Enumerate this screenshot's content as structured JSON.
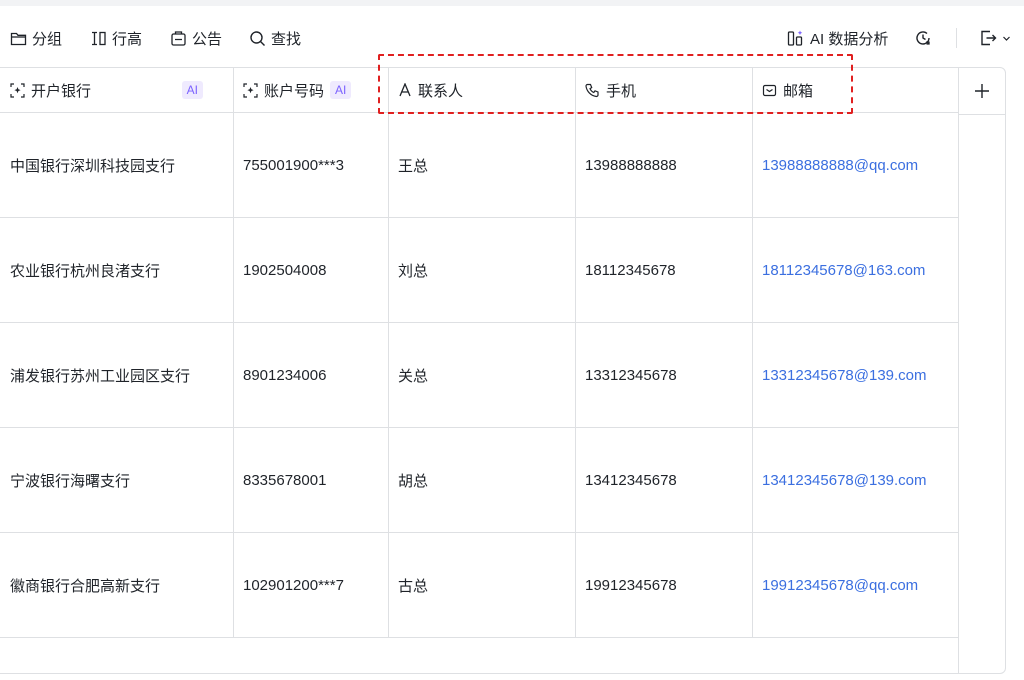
{
  "toolbar": {
    "group": "分组",
    "row_height": "行高",
    "announce": "公告",
    "search": "查找",
    "ai_analysis": "AI 数据分析"
  },
  "columns": [
    {
      "label": "开户银行",
      "icon": "ai-field-icon",
      "ai": "AI"
    },
    {
      "label": "账户号码",
      "icon": "ai-field-icon",
      "ai": "AI"
    },
    {
      "label": "联系人",
      "icon": "text-field-icon"
    },
    {
      "label": "手机",
      "icon": "phone-icon"
    },
    {
      "label": "邮箱",
      "icon": "mail-icon"
    }
  ],
  "rows": [
    {
      "bank": "中国银行深圳科技园支行",
      "account": "755001900***3",
      "contact": "王总",
      "phone": "13988888888",
      "email": "13988888888@qq.com"
    },
    {
      "bank": "农业银行杭州良渚支行",
      "account": "1902504008",
      "contact": "刘总",
      "phone": "18112345678",
      "email": "18112345678@163.com"
    },
    {
      "bank": "浦发银行苏州工业园区支行",
      "account": "8901234006",
      "contact": "关总",
      "phone": "13312345678",
      "email": "13312345678@139.com"
    },
    {
      "bank": "宁波银行海曙支行",
      "account": "8335678001",
      "contact": "胡总",
      "phone": "13412345678",
      "email": "13412345678@139.com"
    },
    {
      "bank": "徽商银行合肥高新支行",
      "account": "102901200***7",
      "contact": "古总",
      "phone": "19912345678",
      "email": "19912345678@qq.com"
    }
  ],
  "colors": {
    "accent": "#3b6fe0",
    "ai": "#7b61ff",
    "highlight": "#e02020"
  }
}
